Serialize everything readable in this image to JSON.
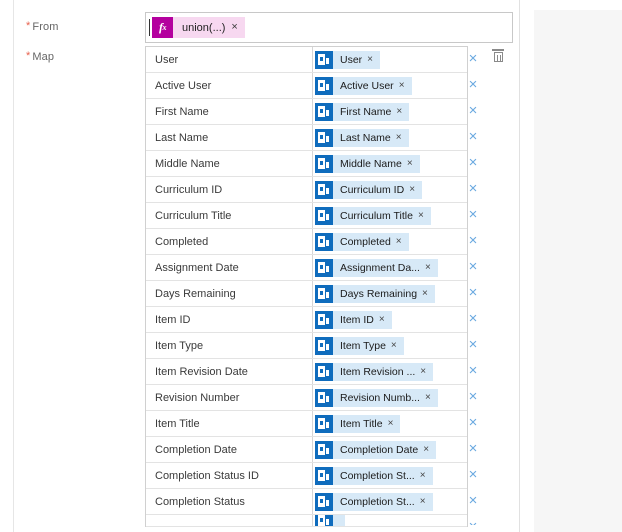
{
  "form": {
    "from": {
      "label": "From",
      "required_marker": "*",
      "expression_value": "union(...)",
      "expression_icon": "fx-icon",
      "chip_remove_label": "×"
    },
    "map": {
      "label": "Map",
      "required_marker": "*",
      "row_delete_label": "×",
      "token_remove_label": "×",
      "token_icon_name": "office-connector-icon",
      "trash_icon_name": "trash-icon",
      "rows": [
        {
          "key": "User",
          "token": "User"
        },
        {
          "key": "Active User",
          "token": "Active User"
        },
        {
          "key": "First Name",
          "token": "First Name"
        },
        {
          "key": "Last Name",
          "token": "Last Name"
        },
        {
          "key": "Middle Name",
          "token": "Middle Name"
        },
        {
          "key": "Curriculum ID",
          "token": "Curriculum ID"
        },
        {
          "key": "Curriculum Title",
          "token": "Curriculum Title"
        },
        {
          "key": "Completed",
          "token": "Completed"
        },
        {
          "key": "Assignment Date",
          "token": "Assignment Da..."
        },
        {
          "key": "Days Remaining",
          "token": "Days Remaining"
        },
        {
          "key": "Item ID",
          "token": "Item ID"
        },
        {
          "key": "Item Type",
          "token": "Item Type"
        },
        {
          "key": "Item Revision Date",
          "token": "Item Revision ..."
        },
        {
          "key": "Revision Number",
          "token": "Revision Numb..."
        },
        {
          "key": "Item Title",
          "token": "Item Title"
        },
        {
          "key": "Completion Date",
          "token": "Completion Date"
        },
        {
          "key": "Completion Status ID",
          "token": "Completion St..."
        },
        {
          "key": "Completion Status",
          "token": "Completion St..."
        },
        {
          "key": "",
          "token": ""
        }
      ]
    }
  },
  "colors": {
    "accent_expression": "#b4009e",
    "accent_token": "#0f6cbd",
    "token_background": "#d7e9f7",
    "required_marker": "#e8614d",
    "delete_icon": "#6aa9e0"
  }
}
